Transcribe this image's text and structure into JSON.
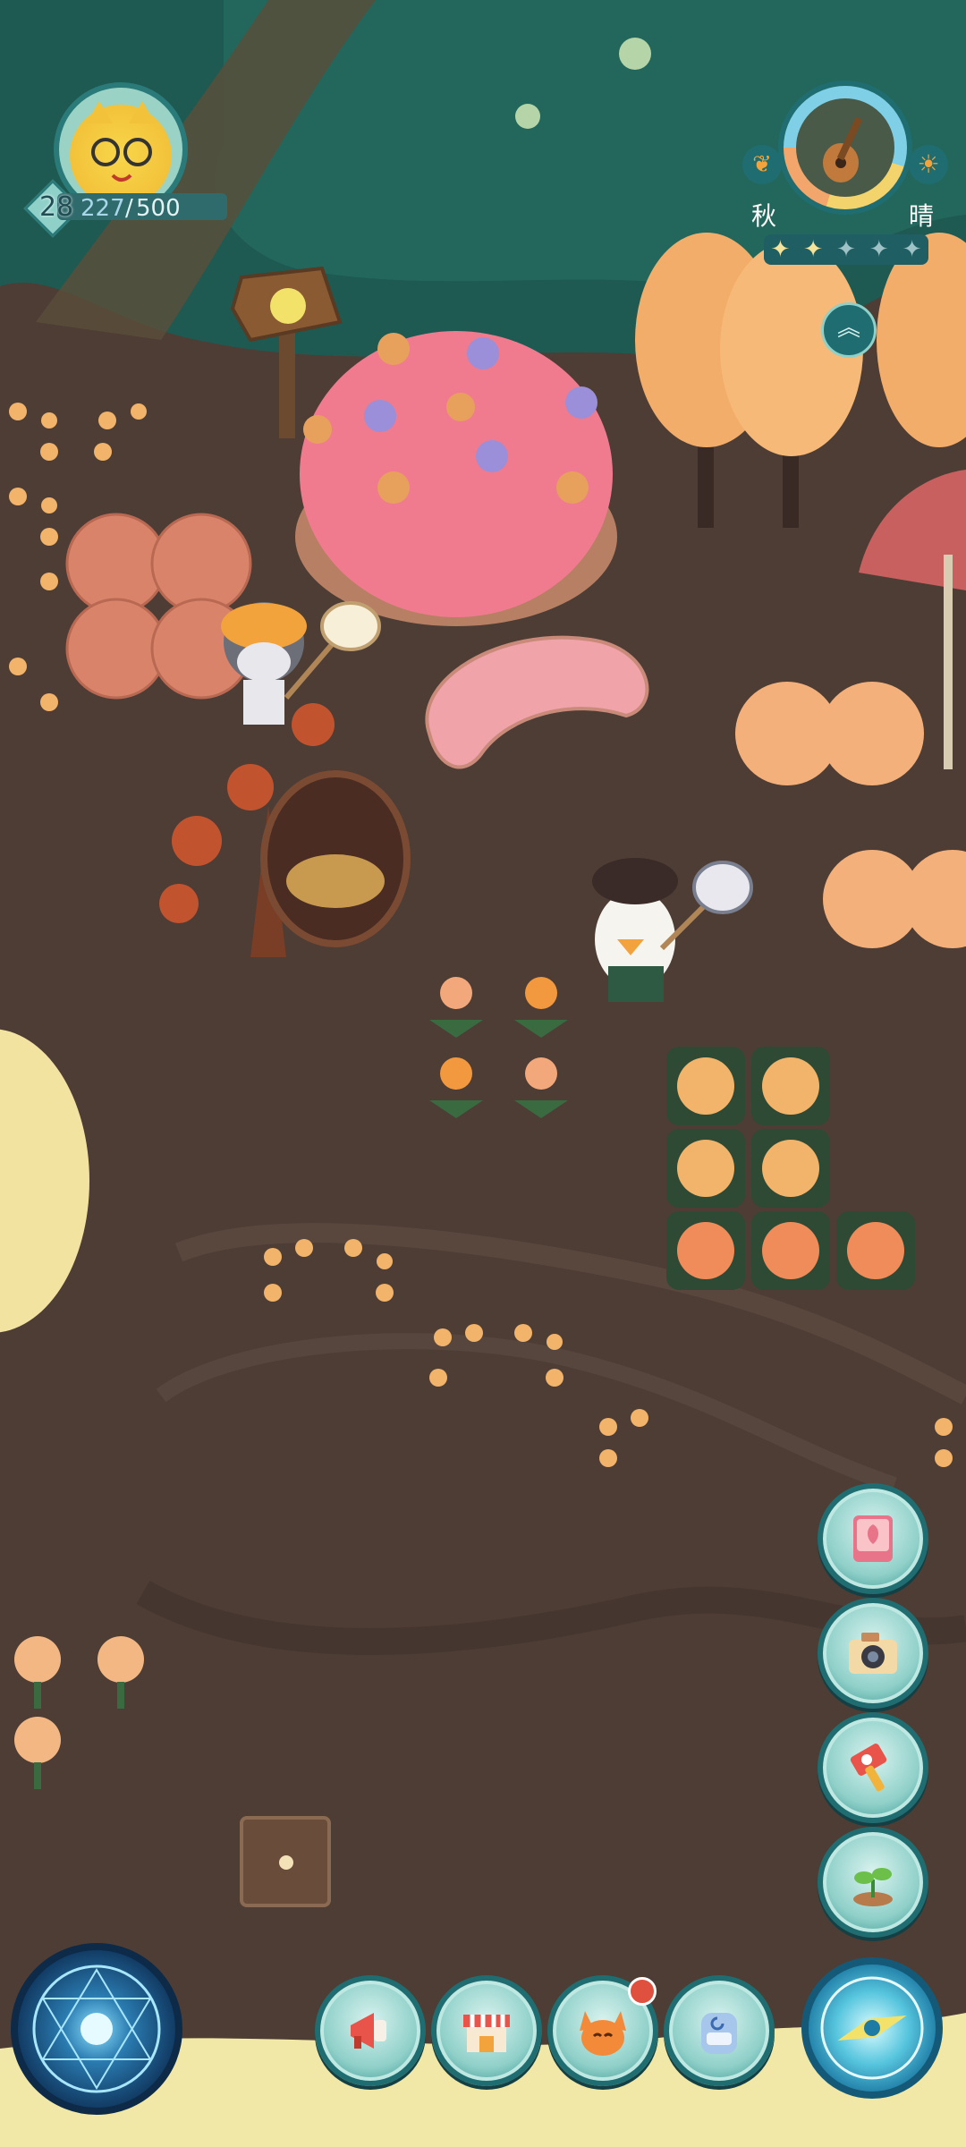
{
  "player": {
    "level": "28",
    "xp_current": "227",
    "xp_separator": "/",
    "xp_max": "500"
  },
  "weather_widget": {
    "season": "秋",
    "weather": "晴",
    "stars_filled": 2,
    "stars_total": 5
  },
  "right_menu": {
    "items": [
      {
        "icon": "book-icon"
      },
      {
        "icon": "camera-icon"
      },
      {
        "icon": "hammer-icon"
      },
      {
        "icon": "sprout-icon"
      }
    ]
  },
  "bottom_bar": {
    "items": [
      {
        "icon": "megaphone-icon"
      },
      {
        "icon": "shop-icon"
      },
      {
        "icon": "fox-icon",
        "notification": true
      },
      {
        "icon": "backpack-icon"
      }
    ]
  },
  "colors": {
    "ui_teal": "#2f8c88",
    "ui_dark_teal": "#1f6d70",
    "ground": "#4a3a33",
    "forest": "#1f5a50",
    "notification_red": "#e0503f"
  }
}
